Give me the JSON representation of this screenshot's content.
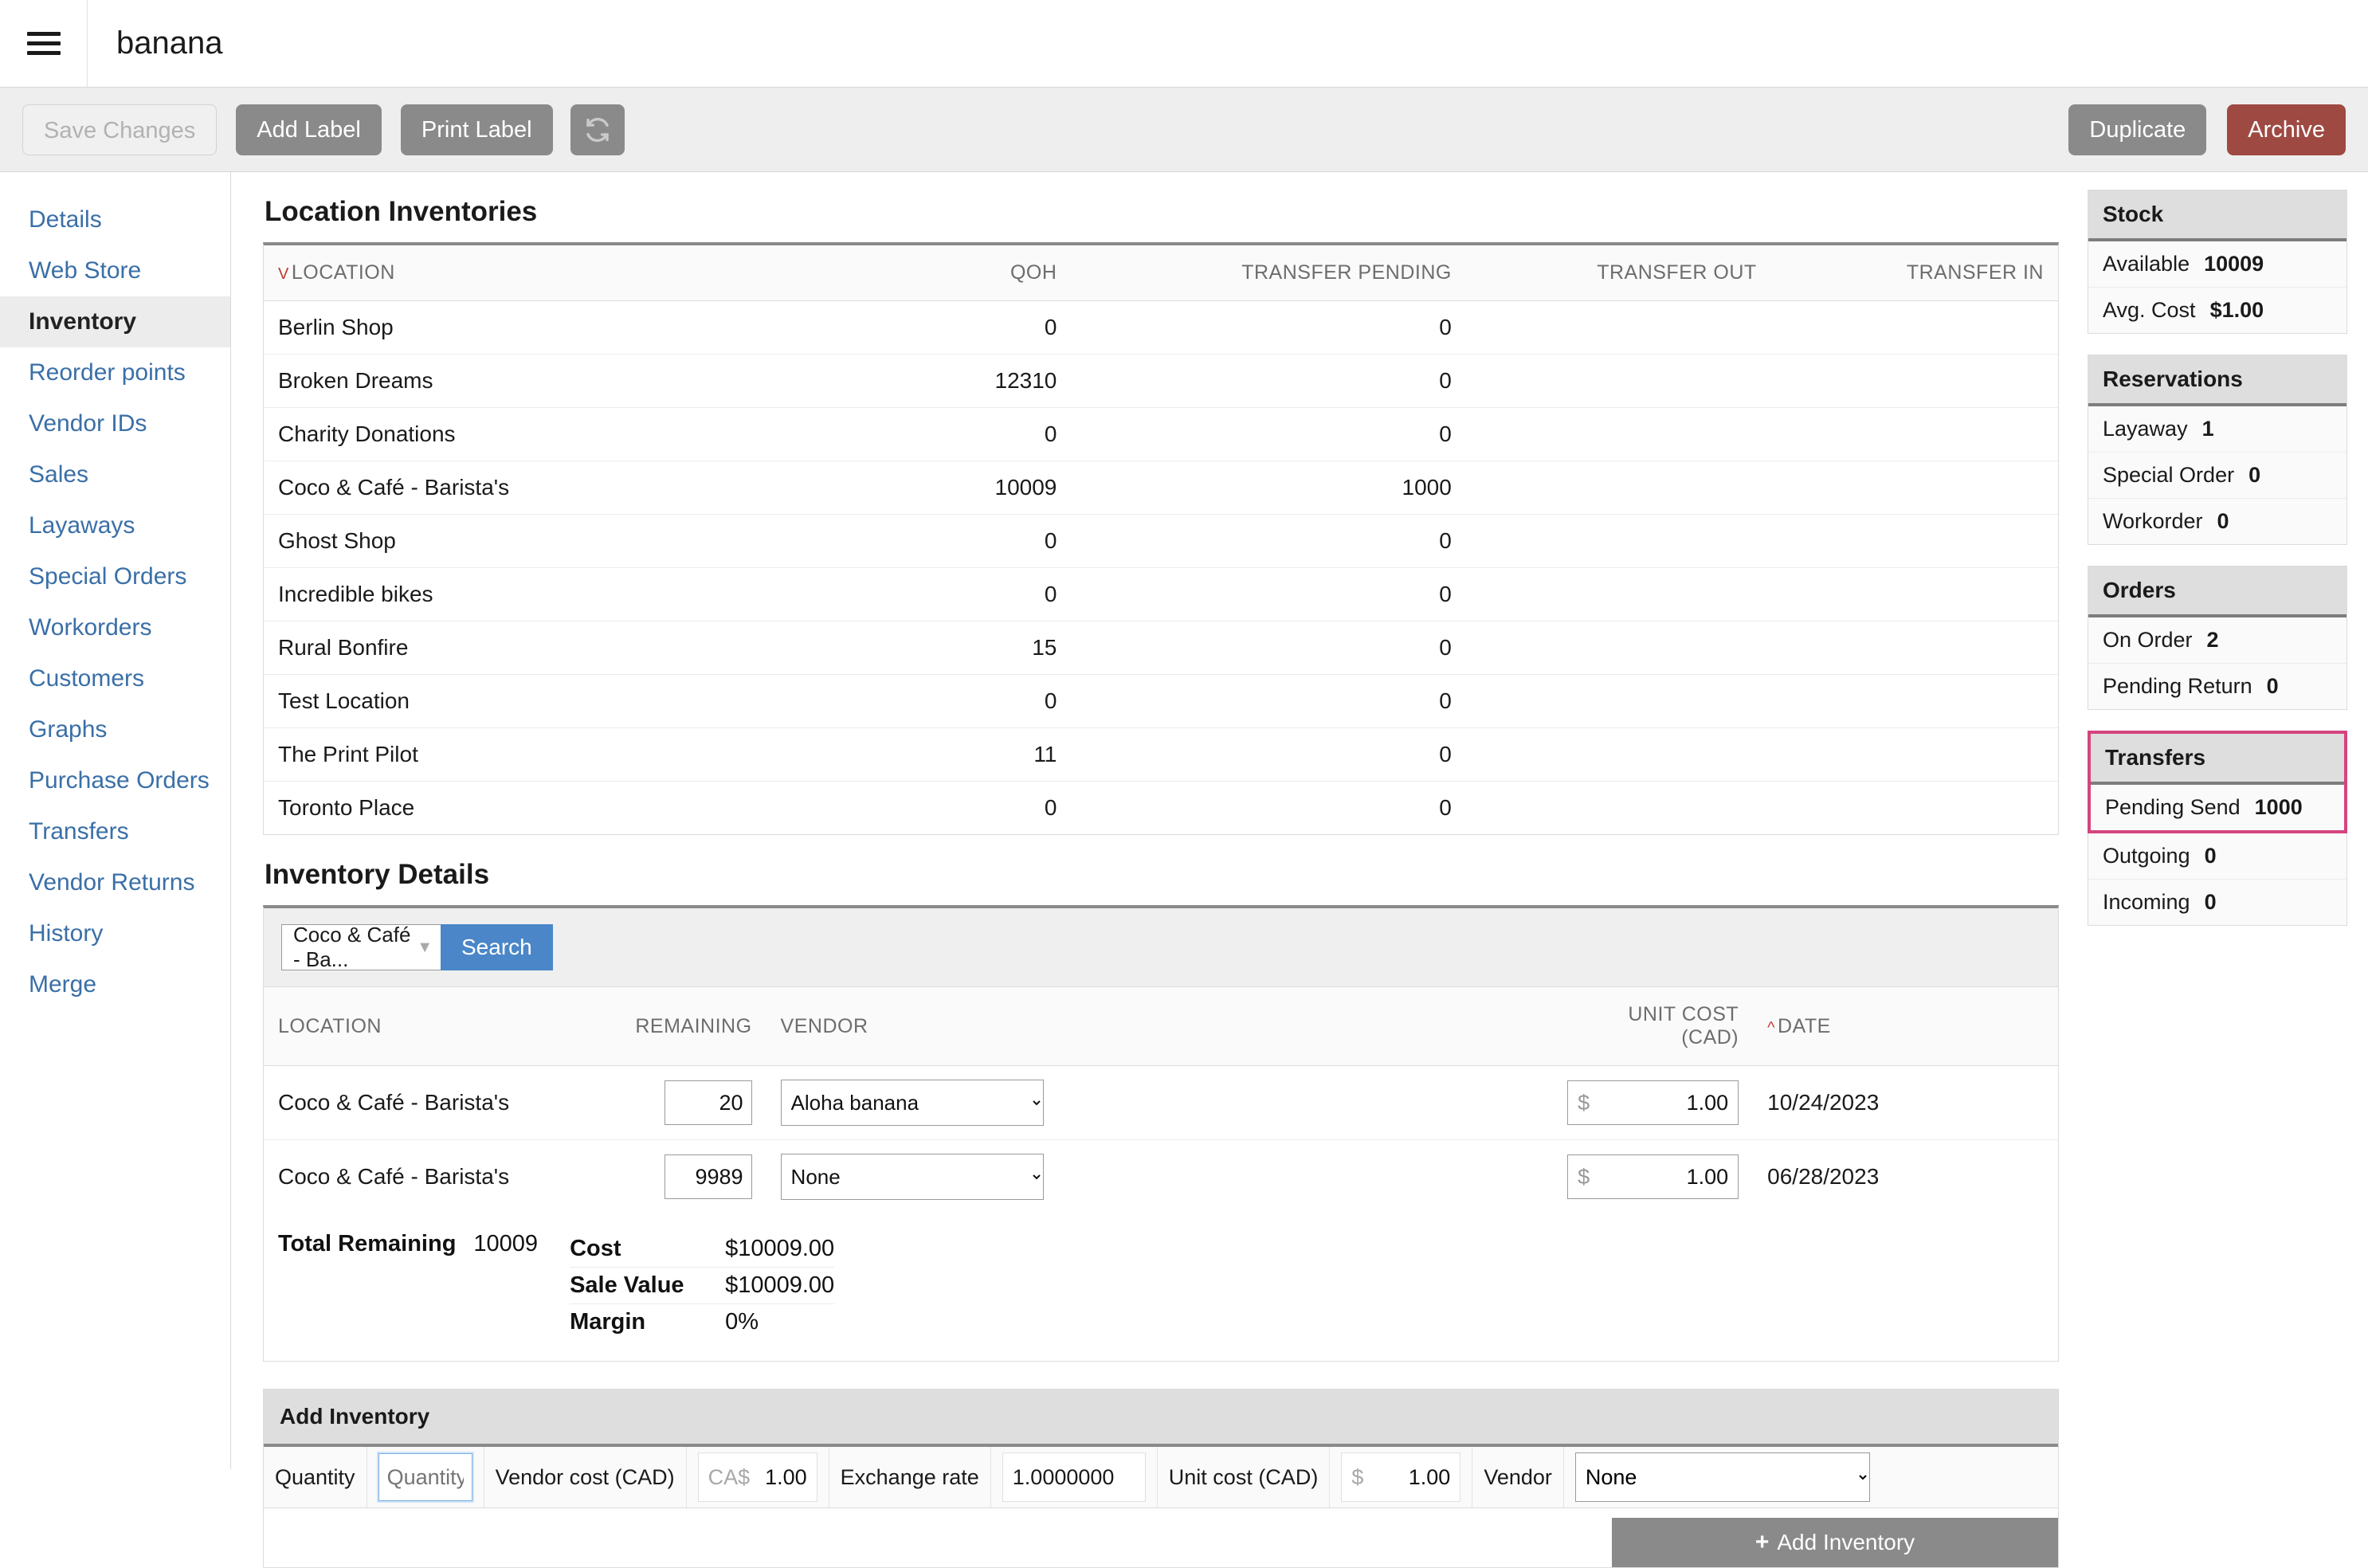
{
  "header": {
    "menu_icon": "hamburger-icon",
    "title": "banana"
  },
  "toolbar": {
    "save_label": "Save Changes",
    "add_label": "Add Label",
    "print_label": "Print Label",
    "refresh_icon": "refresh-icon",
    "duplicate_label": "Duplicate",
    "archive_label": "Archive"
  },
  "sidebar": {
    "items": [
      {
        "label": "Details",
        "active": false
      },
      {
        "label": "Web Store",
        "active": false
      },
      {
        "label": "Inventory",
        "active": true
      },
      {
        "label": "Reorder points",
        "active": false
      },
      {
        "label": "Vendor IDs",
        "active": false
      },
      {
        "label": "Sales",
        "active": false
      },
      {
        "label": "Layaways",
        "active": false
      },
      {
        "label": "Special Orders",
        "active": false
      },
      {
        "label": "Workorders",
        "active": false
      },
      {
        "label": "Customers",
        "active": false
      },
      {
        "label": "Graphs",
        "active": false
      },
      {
        "label": "Purchase Orders",
        "active": false
      },
      {
        "label": "Transfers",
        "active": false
      },
      {
        "label": "Vendor Returns",
        "active": false
      },
      {
        "label": "History",
        "active": false
      },
      {
        "label": "Merge",
        "active": false
      }
    ]
  },
  "location_inventories": {
    "title": "Location Inventories",
    "sort_caret": "v",
    "columns": [
      "LOCATION",
      "QOH",
      "TRANSFER PENDING",
      "TRANSFER OUT",
      "TRANSFER IN"
    ],
    "rows": [
      {
        "location": "Berlin Shop",
        "qoh": "0",
        "transfer_pending": "0",
        "transfer_out": "",
        "transfer_in": ""
      },
      {
        "location": "Broken Dreams",
        "qoh": "12310",
        "transfer_pending": "0",
        "transfer_out": "",
        "transfer_in": ""
      },
      {
        "location": "Charity Donations",
        "qoh": "0",
        "transfer_pending": "0",
        "transfer_out": "",
        "transfer_in": ""
      },
      {
        "location": "Coco & Café - Barista's",
        "qoh": "10009",
        "transfer_pending": "1000",
        "transfer_out": "",
        "transfer_in": ""
      },
      {
        "location": "Ghost Shop",
        "qoh": "0",
        "transfer_pending": "0",
        "transfer_out": "",
        "transfer_in": ""
      },
      {
        "location": "Incredible bikes",
        "qoh": "0",
        "transfer_pending": "0",
        "transfer_out": "",
        "transfer_in": ""
      },
      {
        "location": "Rural Bonfire",
        "qoh": "15",
        "transfer_pending": "0",
        "transfer_out": "",
        "transfer_in": ""
      },
      {
        "location": "Test Location",
        "qoh": "0",
        "transfer_pending": "0",
        "transfer_out": "",
        "transfer_in": ""
      },
      {
        "location": "The Print Pilot",
        "qoh": "11",
        "transfer_pending": "0",
        "transfer_out": "",
        "transfer_in": ""
      },
      {
        "location": "Toronto Place",
        "qoh": "0",
        "transfer_pending": "0",
        "transfer_out": "",
        "transfer_in": ""
      }
    ]
  },
  "inventory_details": {
    "title": "Inventory Details",
    "location_filter_value": "Coco & Café - Ba...",
    "search_label": "Search",
    "columns": {
      "location": "LOCATION",
      "remaining": "REMAINING",
      "vendor": "VENDOR",
      "unit_cost": "UNIT COST",
      "unit_cost_currency": "(CAD)",
      "date": "DATE",
      "date_caret": "^"
    },
    "rows": [
      {
        "location": "Coco & Café - Barista's",
        "remaining": "20",
        "vendor": "Aloha banana",
        "currency_symbol": "$",
        "unit_cost": "1.00",
        "date": "10/24/2023"
      },
      {
        "location": "Coco & Café - Barista's",
        "remaining": "9989",
        "vendor": "None",
        "currency_symbol": "$",
        "unit_cost": "1.00",
        "date": "06/28/2023"
      }
    ],
    "totals": {
      "total_remaining_label": "Total Remaining",
      "total_remaining_value": "10009",
      "cost_label": "Cost",
      "cost_value": "$10009.00",
      "sale_value_label": "Sale Value",
      "sale_value_value": "$10009.00",
      "margin_label": "Margin",
      "margin_value": "0%"
    }
  },
  "add_inventory": {
    "title": "Add Inventory",
    "quantity_label": "Quantity",
    "quantity_placeholder": "Quantity",
    "vendor_cost_label": "Vendor cost (CAD)",
    "vendor_cost_currency": "CA$",
    "vendor_cost_value": "1.00",
    "exchange_rate_label": "Exchange rate",
    "exchange_rate_value": "1.0000000",
    "unit_cost_label": "Unit cost (CAD)",
    "unit_cost_currency": "$",
    "unit_cost_value": "1.00",
    "vendor_label": "Vendor",
    "vendor_value": "None",
    "submit_label": "Add Inventory",
    "submit_icon": "plus-icon"
  },
  "rail": {
    "stock": {
      "title": "Stock",
      "rows": [
        {
          "label": "Available",
          "value": "10009"
        },
        {
          "label": "Avg. Cost",
          "value": "$1.00"
        }
      ]
    },
    "reservations": {
      "title": "Reservations",
      "rows": [
        {
          "label": "Layaway",
          "value": "1"
        },
        {
          "label": "Special Order",
          "value": "0"
        },
        {
          "label": "Workorder",
          "value": "0"
        }
      ]
    },
    "orders": {
      "title": "Orders",
      "rows": [
        {
          "label": "On Order",
          "value": "2"
        },
        {
          "label": "Pending Return",
          "value": "0"
        }
      ]
    },
    "transfers": {
      "title": "Transfers",
      "highlight_color": "#d4457e",
      "rows": [
        {
          "label": "Pending Send",
          "value": "1000"
        },
        {
          "label": "Outgoing",
          "value": "0"
        },
        {
          "label": "Incoming",
          "value": "0"
        }
      ]
    }
  }
}
